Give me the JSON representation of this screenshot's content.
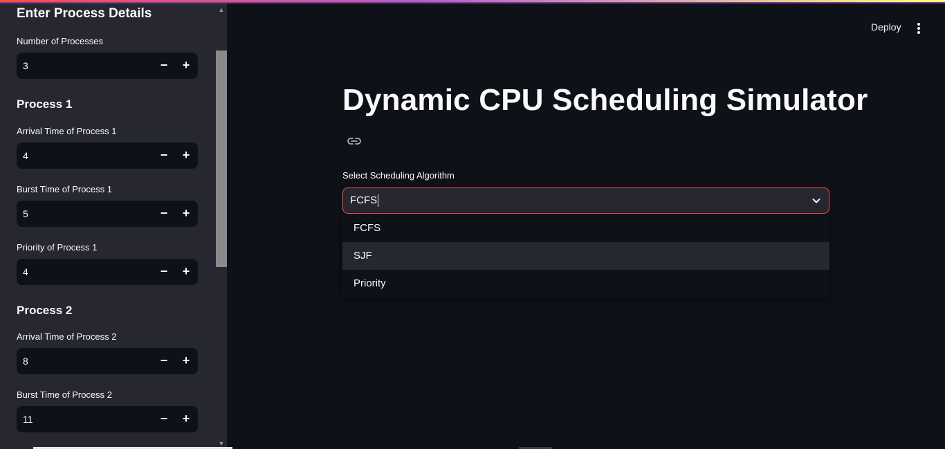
{
  "sidebar": {
    "title": "Enter Process Details",
    "num_processes": {
      "label": "Number of Processes",
      "value": "3"
    },
    "process1": {
      "heading": "Process 1",
      "arrival": {
        "label": "Arrival Time of Process 1",
        "value": "4"
      },
      "burst": {
        "label": "Burst Time of Process 1",
        "value": "5"
      },
      "priority": {
        "label": "Priority of Process 1",
        "value": "4"
      }
    },
    "process2": {
      "heading": "Process 2",
      "arrival": {
        "label": "Arrival Time of Process 2",
        "value": "8"
      },
      "burst": {
        "label": "Burst Time of Process 2",
        "value": "11"
      }
    },
    "stepper": {
      "minus": "−",
      "plus": "+"
    }
  },
  "header": {
    "deploy_label": "Deploy",
    "menu_icon": "kebab-menu-icon"
  },
  "main": {
    "title": "Dynamic CPU Scheduling Simulator",
    "anchor_icon": "link-icon",
    "select": {
      "label": "Select Scheduling Algorithm",
      "value": "FCFS",
      "options": [
        "FCFS",
        "SJF",
        "Priority"
      ]
    }
  },
  "colors": {
    "accent": "#ff4b4b",
    "background": "#0e1117",
    "sidebar": "#262730"
  }
}
